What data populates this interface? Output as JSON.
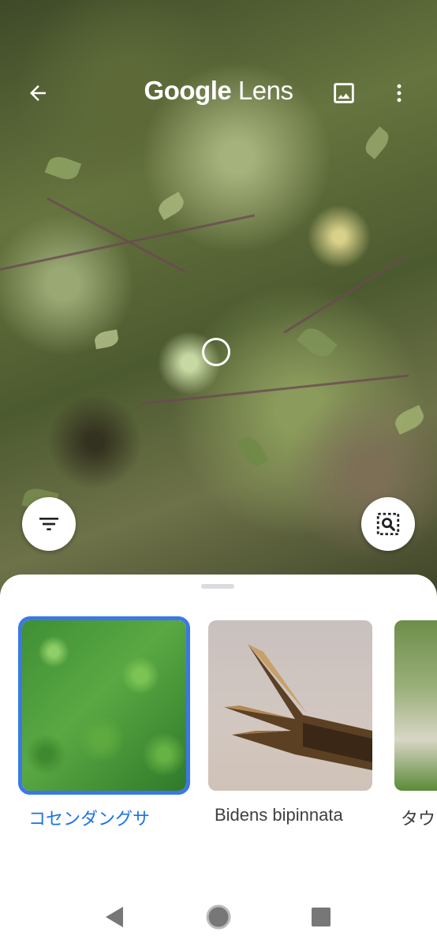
{
  "header": {
    "title_google": "Google",
    "title_lens": "Lens"
  },
  "icons": {
    "back": "arrow-back-icon",
    "gallery": "image-icon",
    "menu": "more-vert-icon",
    "filter": "filter-icon",
    "search_region": "image-search-icon"
  },
  "results": [
    {
      "label": "コセンダングサ",
      "selected": true
    },
    {
      "label": "Bidens bipinnata",
      "selected": false
    },
    {
      "label": "タウ",
      "selected": false
    }
  ],
  "colors": {
    "accent": "#1a73e8",
    "selected_outline": "#3b78e7"
  }
}
